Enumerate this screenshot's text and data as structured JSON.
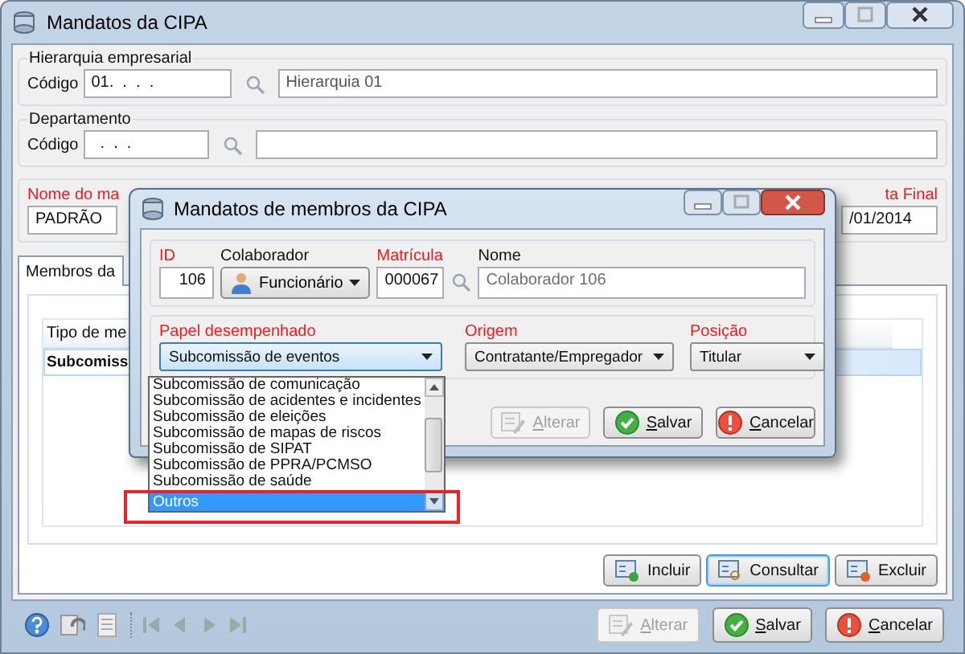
{
  "window": {
    "title": "Mandatos da CIPA"
  },
  "hierarquia": {
    "legend": "Hierarquia empresarial",
    "code_label": "Código",
    "code": "01.  .  .  .",
    "name": "Hierarquia 01"
  },
  "departamento": {
    "legend": "Departamento",
    "code_label": "Código",
    "code": "  .  .  ."
  },
  "mandato": {
    "name_label": "Nome do ma",
    "name": "PADRÃO",
    "end_label": "ta Final",
    "end_date": "/01/2014"
  },
  "members_tab": {
    "label": "Membros da",
    "column_1": "Tipo de me",
    "rows": [
      {
        "cell": "Subcomiss",
        "selected": true
      }
    ]
  },
  "member_buttons": [
    {
      "label": "Incluir",
      "kind": "add",
      "focused": false
    },
    {
      "label": "Consultar",
      "kind": "view",
      "focused": true
    },
    {
      "label": "Excluir",
      "kind": "remove",
      "focused": false
    }
  ],
  "footer_buttons": [
    {
      "label": "Alterar",
      "kind": "edit",
      "disabled": true
    },
    {
      "label": "Salvar",
      "kind": "save",
      "disabled": false
    },
    {
      "label": "Cancelar",
      "kind": "cancel",
      "disabled": false
    }
  ],
  "dialog": {
    "title": "Mandatos de membros da CIPA",
    "id": {
      "label": "ID",
      "required": true,
      "value": "106"
    },
    "colaborador": {
      "label": "Colaborador",
      "required": false,
      "value": "Funcionário"
    },
    "matricula": {
      "label": "Matrícula",
      "required": true,
      "value": "000067"
    },
    "nome": {
      "label": "Nome",
      "required": false,
      "value": "Colaborador 106"
    },
    "papel": {
      "label": "Papel desempenhado",
      "required": true,
      "value": "Subcomissão de eventos"
    },
    "origem": {
      "label": "Origem",
      "required": true,
      "value": "Contratante/Empregador"
    },
    "posicao": {
      "label": "Posição",
      "required": true,
      "value": "Titular"
    },
    "buttons": [
      {
        "label": "Alterar",
        "kind": "edit",
        "disabled": true
      },
      {
        "label": "Salvar",
        "kind": "save",
        "disabled": false
      },
      {
        "label": "Cancelar",
        "kind": "cancel",
        "disabled": false
      }
    ]
  },
  "dropdown": {
    "items": [
      {
        "label": "Subcomissão de comunicação",
        "selected": false
      },
      {
        "label": "Subcomissão de acidentes e incidentes",
        "selected": false
      },
      {
        "label": "Subcomissão de eleições",
        "selected": false
      },
      {
        "label": "Subcomissão de mapas de riscos",
        "selected": false
      },
      {
        "label": "Subcomissão de SIPAT",
        "selected": false
      },
      {
        "label": "Subcomissão de PPRA/PCMSO",
        "selected": false
      },
      {
        "label": "Subcomissão de saúde",
        "selected": false
      },
      {
        "label": "Outros",
        "selected": true
      }
    ]
  }
}
